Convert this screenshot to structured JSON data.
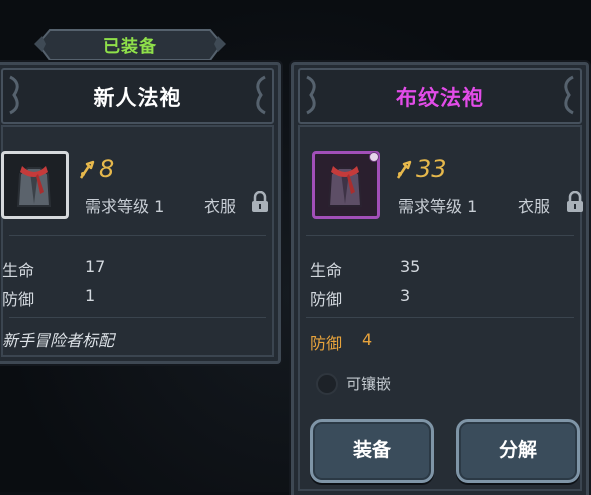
{
  "equipped_tab": {
    "label": "已装备"
  },
  "left_card": {
    "title": "新人法袍",
    "power": "8",
    "requirement": "需求等级 1",
    "slot": "衣服",
    "stats": [
      {
        "name": "生命",
        "value": "17"
      },
      {
        "name": "防御",
        "value": "1"
      }
    ],
    "description": "新手冒险者标配"
  },
  "right_card": {
    "title": "布纹法袍",
    "power": "33",
    "requirement": "需求等级 1",
    "slot": "衣服",
    "stats": [
      {
        "name": "生命",
        "value": "35"
      },
      {
        "name": "防御",
        "value": "3"
      }
    ],
    "bonus_stat": {
      "name": "防御",
      "value": "4"
    },
    "socket_label": "可镶嵌",
    "buttons": {
      "equip": "装备",
      "dismantle": "分解"
    }
  },
  "colors": {
    "equipped_label": "#8fe04a",
    "rare_title": "#e24ce8",
    "power_gold": "#e6b84c",
    "bonus_orange": "#e7a33c",
    "panel_bg": "#242b33"
  },
  "icons": {
    "power": "power-arrow-icon",
    "lock": "lock-icon",
    "item": "robe-with-red-scarf-icon"
  }
}
